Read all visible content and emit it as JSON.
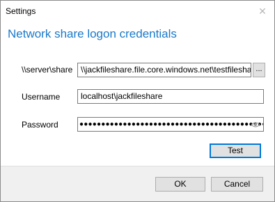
{
  "window": {
    "title": "Settings",
    "close_glyph": "✕"
  },
  "heading": "Network share logon credentials",
  "form": {
    "share_label": "\\\\server\\share",
    "share_value": "\\\\jackfileshare.file.core.windows.net\\testfileshare",
    "browse_label": "...",
    "username_label": "Username",
    "username_value": "localhost\\jackfileshare",
    "password_label": "Password",
    "password_mask": "●●●●●●●●●●●●●●●●●●●●●●●●●●●●●●●●●●●●●●●●●●●●●●●●●●●●●●●●●●",
    "reveal_icon": "eye-icon"
  },
  "buttons": {
    "test": "Test",
    "ok": "OK",
    "cancel": "Cancel"
  },
  "colors": {
    "heading": "#1979ca",
    "default_button_border": "#0078d7",
    "footer_bg": "#f0f0f0"
  }
}
